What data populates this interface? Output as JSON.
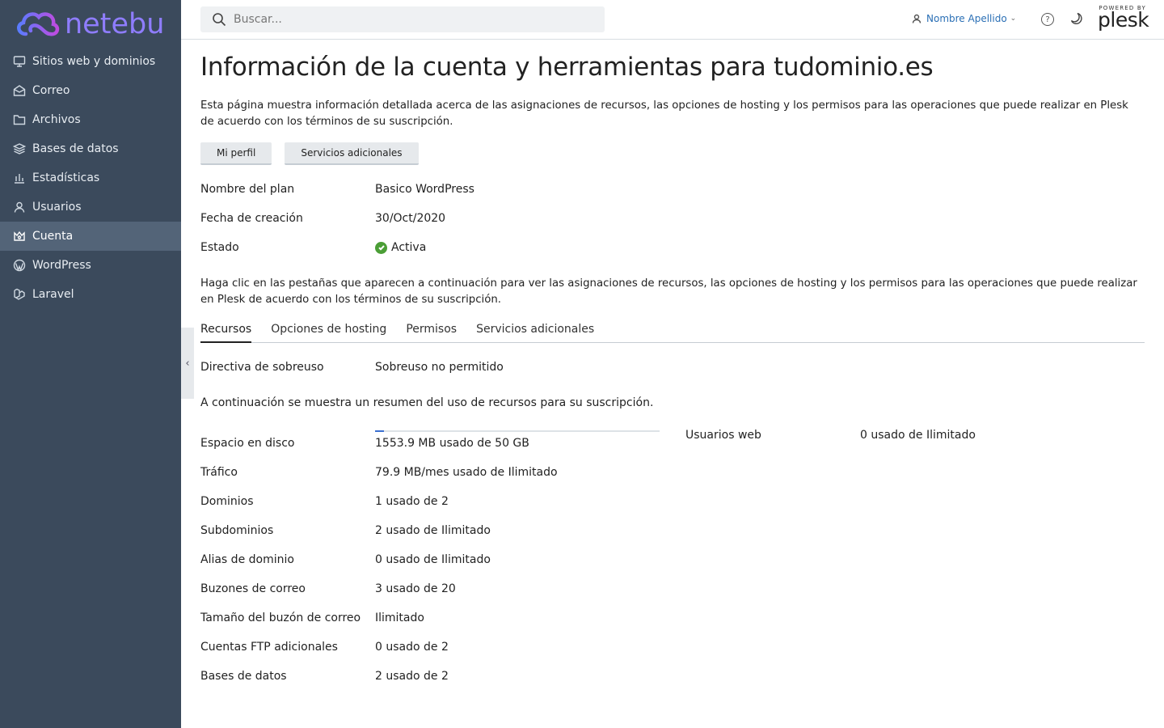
{
  "brand": {
    "name": "netebu"
  },
  "search": {
    "placeholder": "Buscar..."
  },
  "topbar": {
    "user_name": "Nombre Apellido",
    "powered_by": "POWERED BY",
    "plesk": "plesk",
    "help": "?"
  },
  "sidebar": {
    "items": [
      {
        "label": "Sitios web y dominios",
        "icon": "monitor-icon"
      },
      {
        "label": "Correo",
        "icon": "mail-icon"
      },
      {
        "label": "Archivos",
        "icon": "folder-icon"
      },
      {
        "label": "Bases de datos",
        "icon": "database-icon"
      },
      {
        "label": "Estadísticas",
        "icon": "bar-chart-icon"
      },
      {
        "label": "Usuarios",
        "icon": "user-icon"
      },
      {
        "label": "Cuenta",
        "icon": "crown-icon",
        "active": true
      },
      {
        "label": "WordPress",
        "icon": "wordpress-icon"
      },
      {
        "label": "Laravel",
        "icon": "laravel-icon"
      }
    ]
  },
  "page": {
    "title": "Información de la cuenta y herramientas para tudominio.es",
    "description": "Esta página muestra información detallada acerca de las asignaciones de recursos, las opciones de hosting y los permisos para las operaciones que puede realizar en Plesk de acuerdo con los términos de su suscripción.",
    "buttons": {
      "profile": "Mi perfil",
      "services": "Servicios adicionales"
    },
    "plan": {
      "label": "Nombre del plan",
      "value": "Basico WordPress"
    },
    "created": {
      "label": "Fecha de creación",
      "value": "30/Oct/2020"
    },
    "status": {
      "label": "Estado",
      "value": "Activa"
    },
    "tabs_hint": "Haga clic en las pestañas que aparecen a continuación para ver las asignaciones de recursos, las opciones de hosting y los permisos para las operaciones que puede realizar en Plesk de acuerdo con los términos de su suscripción.",
    "tabs": [
      "Recursos",
      "Opciones de hosting",
      "Permisos",
      "Servicios adicionales"
    ],
    "overuse": {
      "label": "Directiva de sobreuso",
      "value": "Sobreuso no permitido"
    },
    "summary": "A continuación se muestra un resumen del uso de recursos para su suscripción.",
    "disk_usage_fraction": 0.03,
    "resources": [
      {
        "label": "Espacio en disco",
        "value": "1553.9 MB usado de 50 GB"
      },
      {
        "label": "Tráfico",
        "value": "79.9 MB/mes usado de Ilimitado"
      },
      {
        "label": "Dominios",
        "value": "1 usado de 2"
      },
      {
        "label": "Subdominios",
        "value": "2 usado de Ilimitado"
      },
      {
        "label": "Alias de dominio",
        "value": "0 usado de Ilimitado"
      },
      {
        "label": "Buzones de correo",
        "value": "3 usado de 20"
      },
      {
        "label": "Tamaño del buzón de correo",
        "value": "Ilimitado"
      },
      {
        "label": "Cuentas FTP adicionales",
        "value": "0 usado de 2"
      },
      {
        "label": "Bases de datos",
        "value": "2 usado de 2"
      }
    ],
    "web_users": {
      "label": "Usuarios web",
      "value": "0 usado de Ilimitado"
    }
  },
  "colors": {
    "sidebar": "#3b4a5c",
    "sidebar_active": "#536478",
    "brand": "#8f7dff",
    "link": "#2a6fb5",
    "ok": "#4b9e36",
    "progress": "#3a6fd0"
  }
}
